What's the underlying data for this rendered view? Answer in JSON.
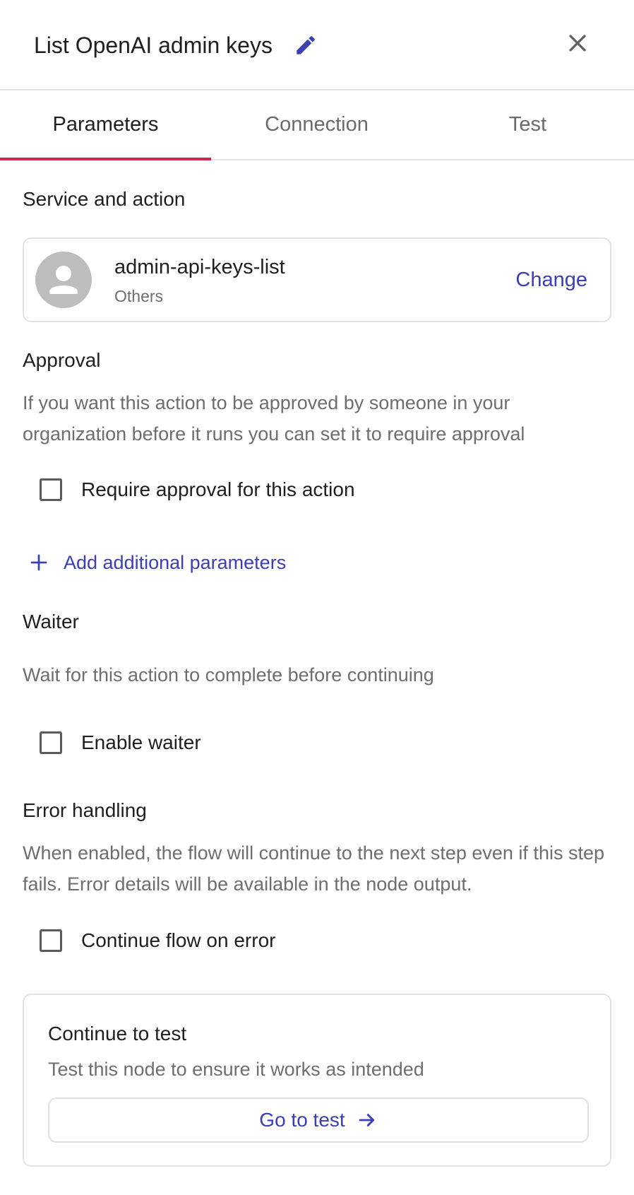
{
  "header": {
    "title": "List OpenAI admin keys"
  },
  "tabs": [
    {
      "label": "Parameters",
      "active": true
    },
    {
      "label": "Connection",
      "active": false
    },
    {
      "label": "Test",
      "active": false
    }
  ],
  "service": {
    "section_title": "Service and action",
    "name": "admin-api-keys-list",
    "category": "Others",
    "change_label": "Change"
  },
  "approval": {
    "title": "Approval",
    "description": "If you want this action to be approved by someone in your organization before it runs you can set it to require approval",
    "checkbox_label": "Require approval for this action",
    "checked": false
  },
  "add_params_label": "Add additional parameters",
  "waiter": {
    "title": "Waiter",
    "description": "Wait for this action to complete before continuing",
    "checkbox_label": "Enable waiter",
    "checked": false
  },
  "error_handling": {
    "title": "Error handling",
    "description": "When enabled, the flow will continue to the next step even if this step fails. Error details will be available in the node output.",
    "checkbox_label": "Continue flow on error",
    "checked": false
  },
  "test_card": {
    "title": "Continue to test",
    "description": "Test this node to ensure it works as intended",
    "button_label": "Go to test"
  },
  "icons": {
    "edit": "pencil-icon",
    "close": "close-icon",
    "avatar": "person-icon",
    "add": "plus-icon",
    "go": "arrow-right-icon"
  },
  "colors": {
    "accent": "#3a3fb5",
    "tab_indicator": "#d0264e",
    "border": "#e3e3e3"
  }
}
